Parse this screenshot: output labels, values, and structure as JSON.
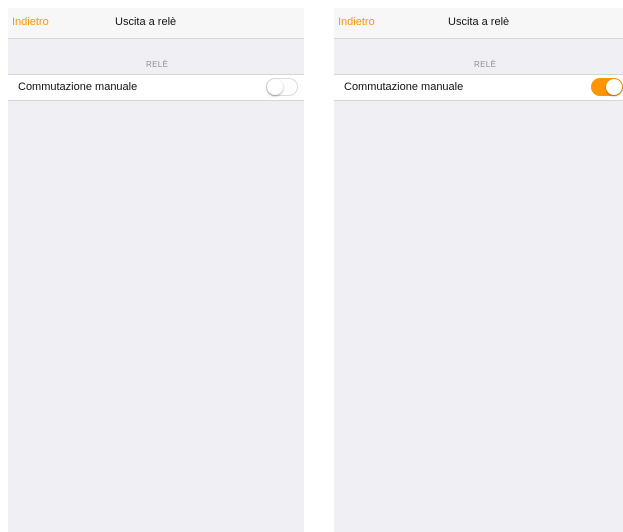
{
  "screens": [
    {
      "nav": {
        "back_label": "Indietro",
        "title": "Uscita a relè"
      },
      "section_header": "RELÈ",
      "rows": [
        {
          "label": "Commutazione manuale",
          "toggle_on": false
        }
      ]
    },
    {
      "nav": {
        "back_label": "Indietro",
        "title": "Uscita a relè"
      },
      "section_header": "RELÈ",
      "rows": [
        {
          "label": "Commutazione manuale",
          "toggle_on": true
        }
      ]
    }
  ],
  "colors": {
    "accent": "#ff9500",
    "background": "#efeff4",
    "navbar": "#f7f7f7",
    "separator": "#d6d6da",
    "section_header_text": "#8e8e93"
  }
}
